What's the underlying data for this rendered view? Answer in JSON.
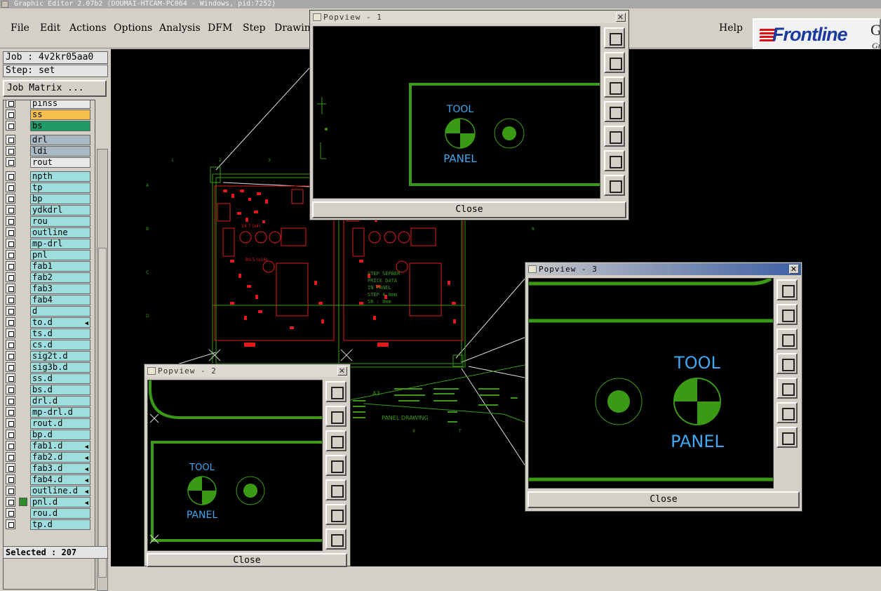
{
  "window": {
    "title": "Graphic Editor 2.07b2 (DOUMAI-HTCAM-PC064 - Windows, pid:7252)"
  },
  "menu": {
    "items": [
      "File",
      "Edit",
      "Actions",
      "Options",
      "Analysis",
      "DFM",
      "Step",
      "Drawing"
    ],
    "help": "Help"
  },
  "brand": {
    "logo": "Frontline",
    "logo_g": "G",
    "logo_gr": "Gr",
    "accent": "#1a3aa0",
    "stripe_color": "#dd1111"
  },
  "job": {
    "job_label": "Job : 4v2kr05aa0",
    "step_label": "Step: set",
    "matrix_button": "Job Matrix ..."
  },
  "layers": [
    {
      "name": "pinss",
      "color": "#e8e8e8"
    },
    {
      "name": "ss",
      "color": "#f5c04a"
    },
    {
      "name": "bs",
      "color": "#1f9b6a"
    },
    {
      "name": "drl",
      "color": "#a8b8c4"
    },
    {
      "name": "ldi",
      "color": "#a8b8c4"
    },
    {
      "name": "rout",
      "color": "#e8e8e8"
    },
    {
      "name": "npth",
      "color": "#9fdede"
    },
    {
      "name": "tp",
      "color": "#9fdede"
    },
    {
      "name": "bp",
      "color": "#9fdede"
    },
    {
      "name": "ydkdrl",
      "color": "#9fdede"
    },
    {
      "name": "rou",
      "color": "#9fdede"
    },
    {
      "name": "outline",
      "color": "#9fdede"
    },
    {
      "name": "mp-drl",
      "color": "#9fdede"
    },
    {
      "name": "pnl",
      "color": "#9fdede"
    },
    {
      "name": "fab1",
      "color": "#9fdede"
    },
    {
      "name": "fab2",
      "color": "#9fdede"
    },
    {
      "name": "fab3",
      "color": "#9fdede"
    },
    {
      "name": "fab4",
      "color": "#9fdede"
    },
    {
      "name": "d",
      "color": "#9fdede"
    },
    {
      "name": "to.d",
      "color": "#9fdede",
      "arrow": true
    },
    {
      "name": "ts.d",
      "color": "#9fdede"
    },
    {
      "name": "cs.d",
      "color": "#9fdede"
    },
    {
      "name": "sig2t.d",
      "color": "#9fdede"
    },
    {
      "name": "sig3b.d",
      "color": "#9fdede"
    },
    {
      "name": "ss.d",
      "color": "#9fdede"
    },
    {
      "name": "bs.d",
      "color": "#9fdede"
    },
    {
      "name": "drl.d",
      "color": "#9fdede"
    },
    {
      "name": "mp-drl.d",
      "color": "#9fdede"
    },
    {
      "name": "rout.d",
      "color": "#9fdede"
    },
    {
      "name": "bp.d",
      "color": "#9fdede"
    },
    {
      "name": "fab1.d",
      "color": "#9fdede",
      "arrow": true
    },
    {
      "name": "fab2.d",
      "color": "#9fdede",
      "arrow": true
    },
    {
      "name": "fab3.d",
      "color": "#9fdede",
      "arrow": true
    },
    {
      "name": "fab4.d",
      "color": "#9fdede",
      "arrow": true
    },
    {
      "name": "outline.d",
      "color": "#9fdede",
      "arrow": true
    },
    {
      "name": "pnl.d",
      "color": "#9fdede",
      "arrow": true,
      "checked": true
    },
    {
      "name": "rou.d",
      "color": "#9fdede"
    },
    {
      "name": "tp.d",
      "color": "#9fdede"
    }
  ],
  "status": {
    "selected": "Selected : 207"
  },
  "canvas": {
    "step_note": [
      "STEP SEPBER",
      "PRICE DATA",
      "IN PANEL",
      "STEP 4.0mm",
      "SR : 0mm"
    ],
    "panel_drawing": "PANEL DRAWING",
    "a3": "A3",
    "marker_a": "14.7 (x4)",
    "marker_b": "R0.5 (x16)"
  },
  "popups": [
    {
      "title": "Popview - 1",
      "close": "Close",
      "tool_label": "TOOL",
      "panel_label": "PANEL"
    },
    {
      "title": "Popview - 2",
      "close": "Close",
      "tool_label": "TOOL",
      "panel_label": "PANEL"
    },
    {
      "title": "Popview - 3",
      "close": "Close",
      "tool_label": "TOOL",
      "panel_label": "PANEL"
    }
  ],
  "colors": {
    "trace_green": "#3a9a16",
    "cad_red": "#e01a1a",
    "label_blue": "#3fa8f0"
  }
}
